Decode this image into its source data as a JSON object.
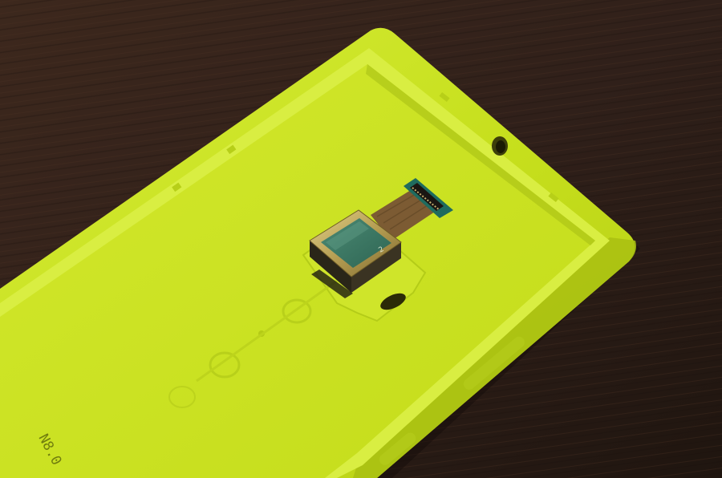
{
  "photo": {
    "subject": "",
    "palette": {
      "table": "#3a251b",
      "table_dark": "#1f140e",
      "cover": "#c9e21c",
      "cover_light": "#dcf04a",
      "cover_shadow": "#8ea312",
      "module_gold": "#b8a25a",
      "sensor": "#3f7a66",
      "flex": "#7b5a35",
      "connector_pcb": "#1f6b5e"
    }
  },
  "markings": {
    "module_digit": "2",
    "case_text": "N8.0"
  }
}
